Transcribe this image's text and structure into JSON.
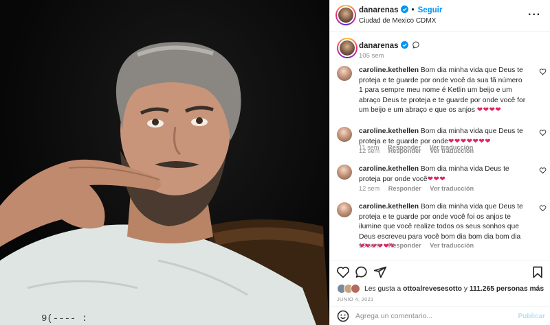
{
  "post": {
    "author": "danarenas",
    "follow_label": "Seguir",
    "location": "Ciudad de Mexico CDMX",
    "caption_time": "105 sem",
    "date": "JUNIO 4, 2021"
  },
  "comments": [
    {
      "user": "caroline.kethellen",
      "text": "Bom dia minha vida que Deus te proteja e te guarde por onde você da sua fã número 1 para sempre meu nome é Ketlin um beijo e um abraço Deus te proteja e te guarde por onde você for um beijo e um abraço e que os anjos",
      "hearts": "❤❤❤❤",
      "time": "11 sem",
      "reply": "Responder",
      "translate": "Ver traducción"
    },
    {
      "user": "caroline.kethellen",
      "text": "Bom dia minha vida que Deus te proteja e te guarde por onde",
      "hearts": "❤❤❤❤❤❤❤",
      "time": "12 sem",
      "reply": "Responder",
      "translate": "Ver traducción"
    },
    {
      "user": "caroline.kethellen",
      "text": "Bom dia minha vida Deus te proteja por onde você",
      "hearts": "❤❤❤",
      "time": "12 sem",
      "reply": "Responder",
      "translate": "Ver traducción"
    },
    {
      "user": "caroline.kethellen",
      "text": "Bom dia minha vida que Deus te proteja e te guarde por onde você foi os anjos te ilumine que você realize todos os seus sonhos que Deus escreveu para você bom dia bom dia bom dia",
      "hearts": "❤❤❤❤❤❤",
      "time": "13 sem",
      "reply": "Responder",
      "translate": "Ver traducción"
    }
  ],
  "likes": {
    "prefix": "Les gusta a",
    "user": "ottoalrevesesotto",
    "middle": "y",
    "count": "111.265 personas más"
  },
  "comment_box": {
    "placeholder": "Agrega un comentario...",
    "publish_label": "Publicar"
  },
  "colors": {
    "accent": "#0095f6",
    "heart": "#e0245e",
    "muted": "#8e8e8e",
    "publish_disabled": "#b2dffc"
  },
  "icons": [
    "verified-badge-icon",
    "more-options-icon",
    "speech-bubble-icon",
    "heart-outline-icon",
    "comment-icon",
    "share-icon",
    "bookmark-icon",
    "emoji-icon"
  ]
}
